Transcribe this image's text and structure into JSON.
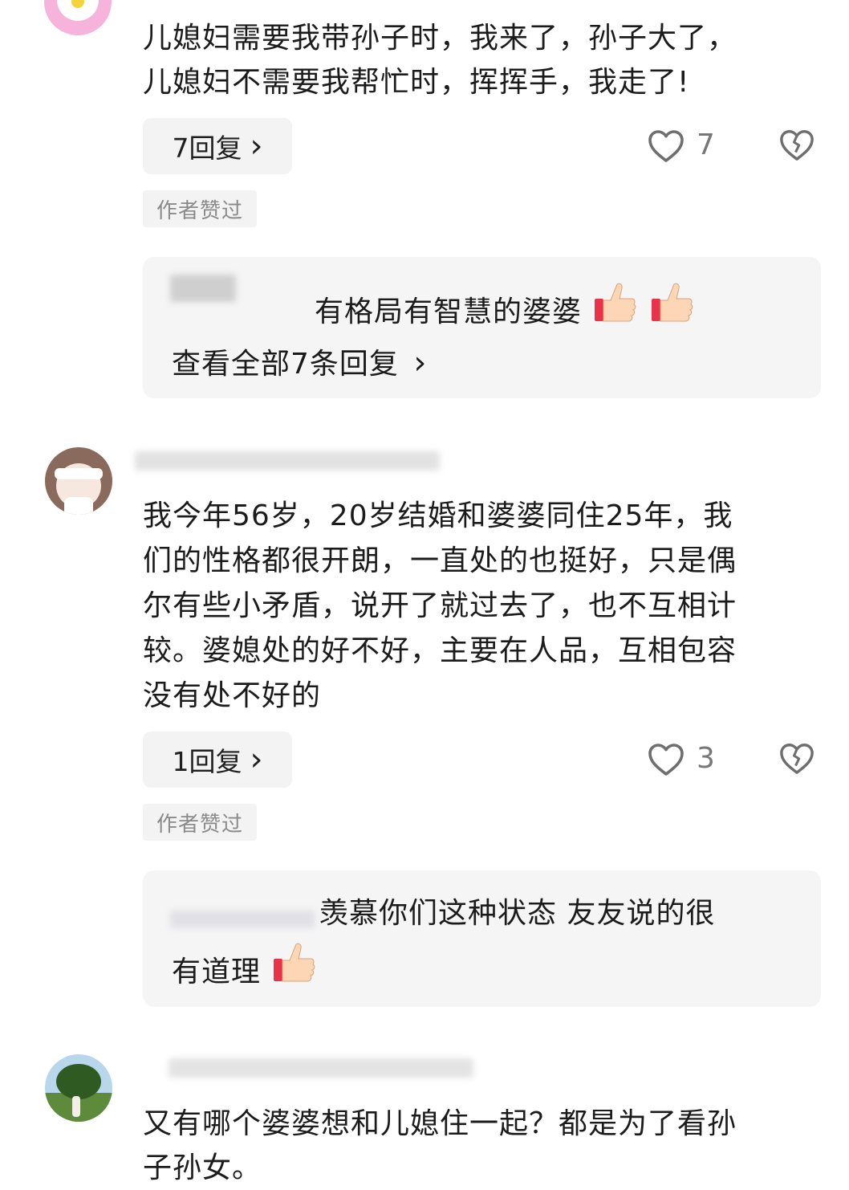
{
  "comments": [
    {
      "text_line1": "儿媳妇需要我带孙子时，我来了，孙子大了，",
      "text_line2": "儿媳妇不需要我帮忙时，挥挥手，我走了!",
      "reply_button": "7回复",
      "like_count": "7",
      "author_liked": "作者赞过",
      "reply_preview": "有格局有智慧的婆婆",
      "view_all": "查看全部7条回复"
    },
    {
      "text_lines": [
        "我今年56岁，20岁结婚和婆婆同住25年，我",
        "们的性格都很开朗，一直处的也挺好，只是偶",
        "尔有些小矛盾，说开了就过去了，也不互相计",
        "较。婆媳处的好不好，主要在人品，互相包容",
        "没有处不好的"
      ],
      "reply_button": "1回复",
      "like_count": "3",
      "author_liked": "作者赞过",
      "reply_preview_line1": "羡慕你们这种状态 友友说的很",
      "reply_preview_line2": "有道理"
    },
    {
      "text_line1": "又有哪个婆婆想和儿媳住一起？都是为了看孙",
      "text_line2": "子孙女。"
    }
  ],
  "icons": {
    "chevron": "›",
    "heart": "heart-icon",
    "dislike": "broken-heart-icon",
    "thumbs_up": "thumbs-up-emoji"
  }
}
